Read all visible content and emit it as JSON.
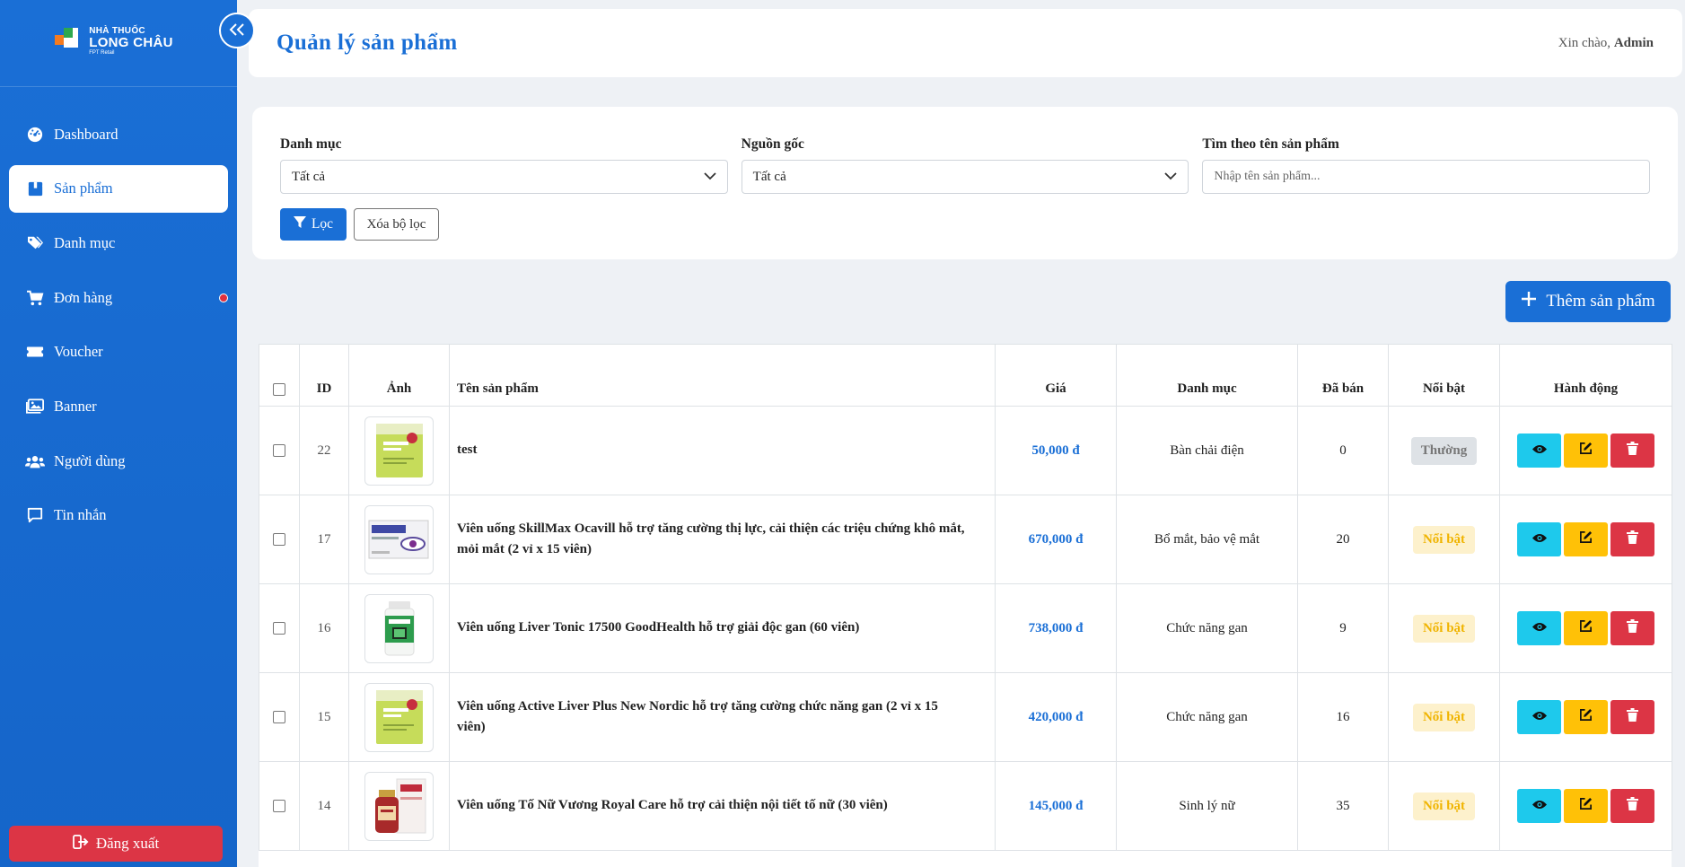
{
  "brand": {
    "line1": "NHÀ THUỐC",
    "line2": "LONG CHÂU",
    "sub": "FPT Retail"
  },
  "sidebar": {
    "items": [
      {
        "key": "dashboard",
        "label": "Dashboard",
        "icon": "gauge-icon"
      },
      {
        "key": "products",
        "label": "Sản phẩm",
        "icon": "box-icon",
        "active": true
      },
      {
        "key": "categories",
        "label": "Danh mục",
        "icon": "tags-icon"
      },
      {
        "key": "orders",
        "label": "Đơn hàng",
        "icon": "cart-icon"
      },
      {
        "key": "voucher",
        "label": "Voucher",
        "icon": "ticket-icon"
      },
      {
        "key": "banner",
        "label": "Banner",
        "icon": "image-icon"
      },
      {
        "key": "users",
        "label": "Người dùng",
        "icon": "users-icon"
      },
      {
        "key": "messages",
        "label": "Tin nhắn",
        "icon": "chat-icon"
      }
    ],
    "logout_label": "Đăng xuất"
  },
  "header": {
    "title": "Quản lý sản phẩm",
    "greeting": "Xin chào,",
    "user": "Admin"
  },
  "filter": {
    "category_label": "Danh mục",
    "category_value": "Tất cả",
    "origin_label": "Nguồn gốc",
    "origin_value": "Tất cả",
    "search_label": "Tìm theo tên sản phẩm",
    "search_placeholder": "Nhập tên sản phẩm...",
    "filter_button": "Lọc",
    "clear_button": "Xóa bộ lọc"
  },
  "add_button": "Thêm sản phẩm",
  "table": {
    "headers": {
      "id": "ID",
      "image": "Ảnh",
      "name": "Tên sản phẩm",
      "price": "Giá",
      "category": "Danh mục",
      "sold": "Đã bán",
      "featured": "Nổi bật",
      "actions": "Hành động"
    },
    "rows": [
      {
        "id": "22",
        "name": "test",
        "price": "50,000 đ",
        "category": "Bàn chải điện",
        "sold": "0",
        "featured": "Thường",
        "featured_type": "normal",
        "thumb": "active-liver"
      },
      {
        "id": "17",
        "name": "Viên uống SkillMax Ocavill hỗ trợ tăng cường thị lực, cải thiện các triệu chứng khô mắt, mỏi mắt (2 vỉ x 15 viên)",
        "price": "670,000 đ",
        "category": "Bổ mắt, bảo vệ mắt",
        "sold": "20",
        "featured": "Nổi bật",
        "featured_type": "hot",
        "thumb": "skillmax"
      },
      {
        "id": "16",
        "name": "Viên uống Liver Tonic 17500 GoodHealth hỗ trợ giải độc gan (60 viên)",
        "price": "738,000 đ",
        "category": "Chức năng gan",
        "sold": "9",
        "featured": "Nổi bật",
        "featured_type": "hot",
        "thumb": "bottle"
      },
      {
        "id": "15",
        "name": "Viên uống Active Liver Plus New Nordic hỗ trợ tăng cường chức năng gan (2 vỉ x 15 viên)",
        "price": "420,000 đ",
        "category": "Chức năng gan",
        "sold": "16",
        "featured": "Nổi bật",
        "featured_type": "hot",
        "thumb": "active-liver"
      },
      {
        "id": "14",
        "name": "Viên uống Tố Nữ Vương Royal Care hỗ trợ cải thiện nội tiết tố nữ (30 viên)",
        "price": "145,000 đ",
        "category": "Sinh lý nữ",
        "sold": "35",
        "featured": "Nổi bật",
        "featured_type": "hot",
        "thumb": "royal"
      }
    ]
  },
  "colors": {
    "primary": "#1a6fd6",
    "danger": "#dc3545",
    "warning": "#ffc107",
    "info": "#1ec9ec"
  }
}
